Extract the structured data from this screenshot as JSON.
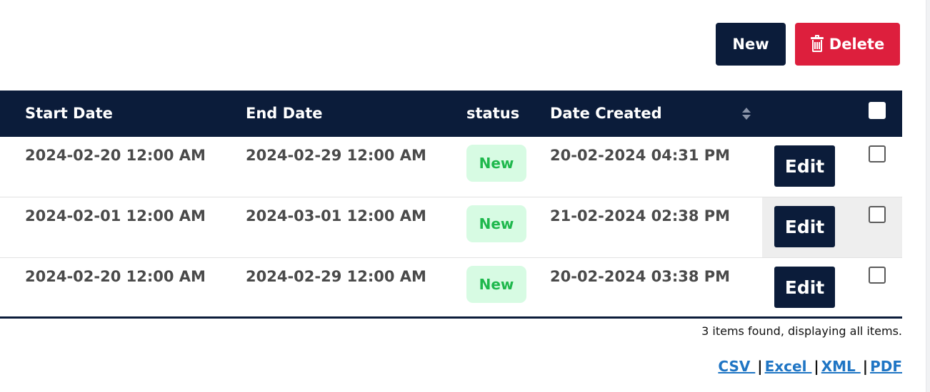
{
  "toolbar": {
    "new_label": "New",
    "delete_label": "Delete",
    "delete_icon": "trash-icon"
  },
  "table": {
    "columns": [
      "Start Date",
      "End Date",
      "status",
      "Date Created"
    ],
    "sortable_column": "Date Created",
    "rows": [
      {
        "start_date": "2024-02-20 12:00 AM",
        "end_date": "2024-02-29 12:00 AM",
        "status": "New",
        "date_created": "20-02-2024 04:31 PM",
        "edit_label": "Edit"
      },
      {
        "start_date": "2024-02-01 12:00 AM",
        "end_date": "2024-03-01 12:00 AM",
        "status": "New",
        "date_created": "21-02-2024 02:38 PM",
        "edit_label": "Edit"
      },
      {
        "start_date": "2024-02-20 12:00 AM",
        "end_date": "2024-02-29 12:00 AM",
        "status": "New",
        "date_created": "20-02-2024 03:38 PM",
        "edit_label": "Edit"
      }
    ]
  },
  "summary": "3 items found, displaying all items.",
  "exports": {
    "csv": "CSV ",
    "excel": "Excel ",
    "xml": "XML ",
    "pdf": "PDF",
    "separator": "|"
  },
  "colors": {
    "header_bg": "#0b1c3a",
    "delete_bg": "#dd1f3d",
    "status_bg": "#d7fbe3",
    "status_text": "#1fb84d",
    "link": "#1f75c4"
  }
}
